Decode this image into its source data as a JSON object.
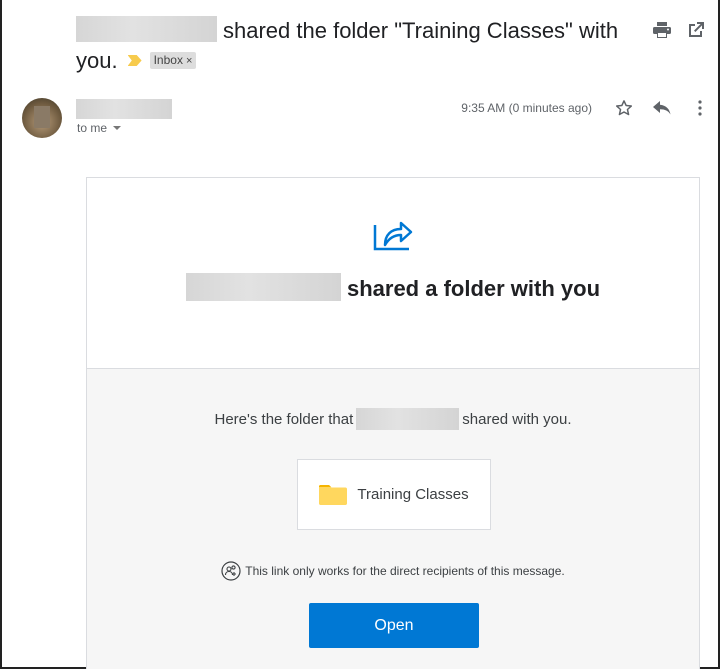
{
  "subject": {
    "text": "shared the folder \"Training Classes\" with you.",
    "label": "Inbox",
    "label_close": "×"
  },
  "toolbar": {
    "print_icon": "print-icon",
    "popout_icon": "open-in-new-window-icon"
  },
  "message": {
    "recipient": "to me",
    "time": "9:35 AM (0 minutes ago)",
    "star_icon": "star-icon",
    "reply_icon": "reply-icon",
    "more_icon": "more-vert-icon"
  },
  "card": {
    "headline": "shared a folder with you",
    "intro_before": "Here's the folder that",
    "intro_after": "shared with you.",
    "folder_name": "Training Classes",
    "notice": "This link only works for the direct recipients of this message.",
    "open_button": "Open",
    "accent_color": "#0078d4",
    "folder_color": "#ffd75e"
  }
}
